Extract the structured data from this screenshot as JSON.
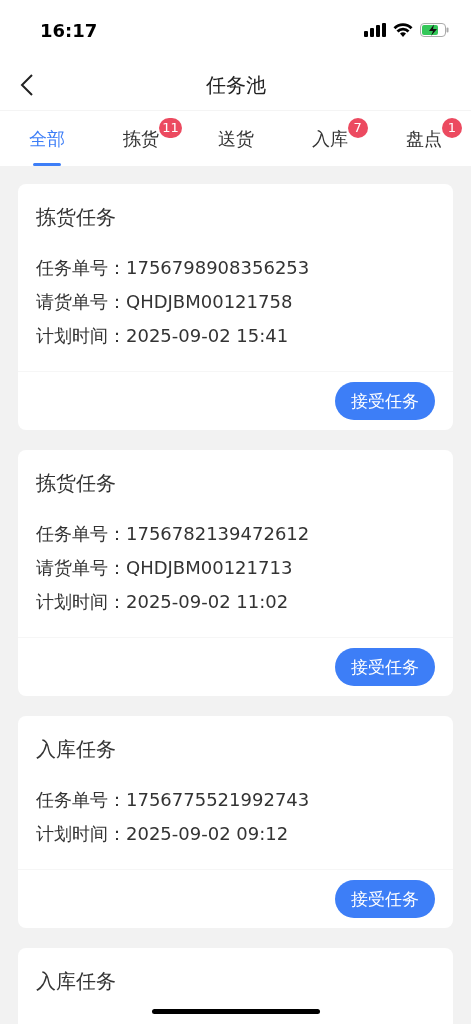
{
  "status_bar": {
    "time": "16:17"
  },
  "nav": {
    "title": "任务池"
  },
  "tabs": [
    {
      "label": "全部",
      "selected": true
    },
    {
      "label": "拣货",
      "selected": false,
      "badge": "11"
    },
    {
      "label": "送货",
      "selected": false
    },
    {
      "label": "入库",
      "selected": false,
      "badge": "7"
    },
    {
      "label": "盘点",
      "selected": false,
      "badge": "1"
    }
  ],
  "tasks": [
    {
      "title": "拣货任务",
      "fields": [
        {
          "label": "任务单号：",
          "value": "1756798908356253"
        },
        {
          "label": "请货单号：",
          "value": "QHDJBM00121758"
        },
        {
          "label": "计划时间：",
          "value": "2025-09-02 15:41"
        }
      ],
      "action": "接受任务"
    },
    {
      "title": "拣货任务",
      "fields": [
        {
          "label": "任务单号：",
          "value": "1756782139472612"
        },
        {
          "label": "请货单号：",
          "value": "QHDJBM00121713"
        },
        {
          "label": "计划时间：",
          "value": "2025-09-02 11:02"
        }
      ],
      "action": "接受任务"
    },
    {
      "title": "入库任务",
      "fields": [
        {
          "label": "任务单号：",
          "value": "1756775521992743"
        },
        {
          "label": "计划时间：",
          "value": "2025-09-02 09:12"
        }
      ],
      "action": "接受任务"
    },
    {
      "title": "入库任务"
    }
  ]
}
